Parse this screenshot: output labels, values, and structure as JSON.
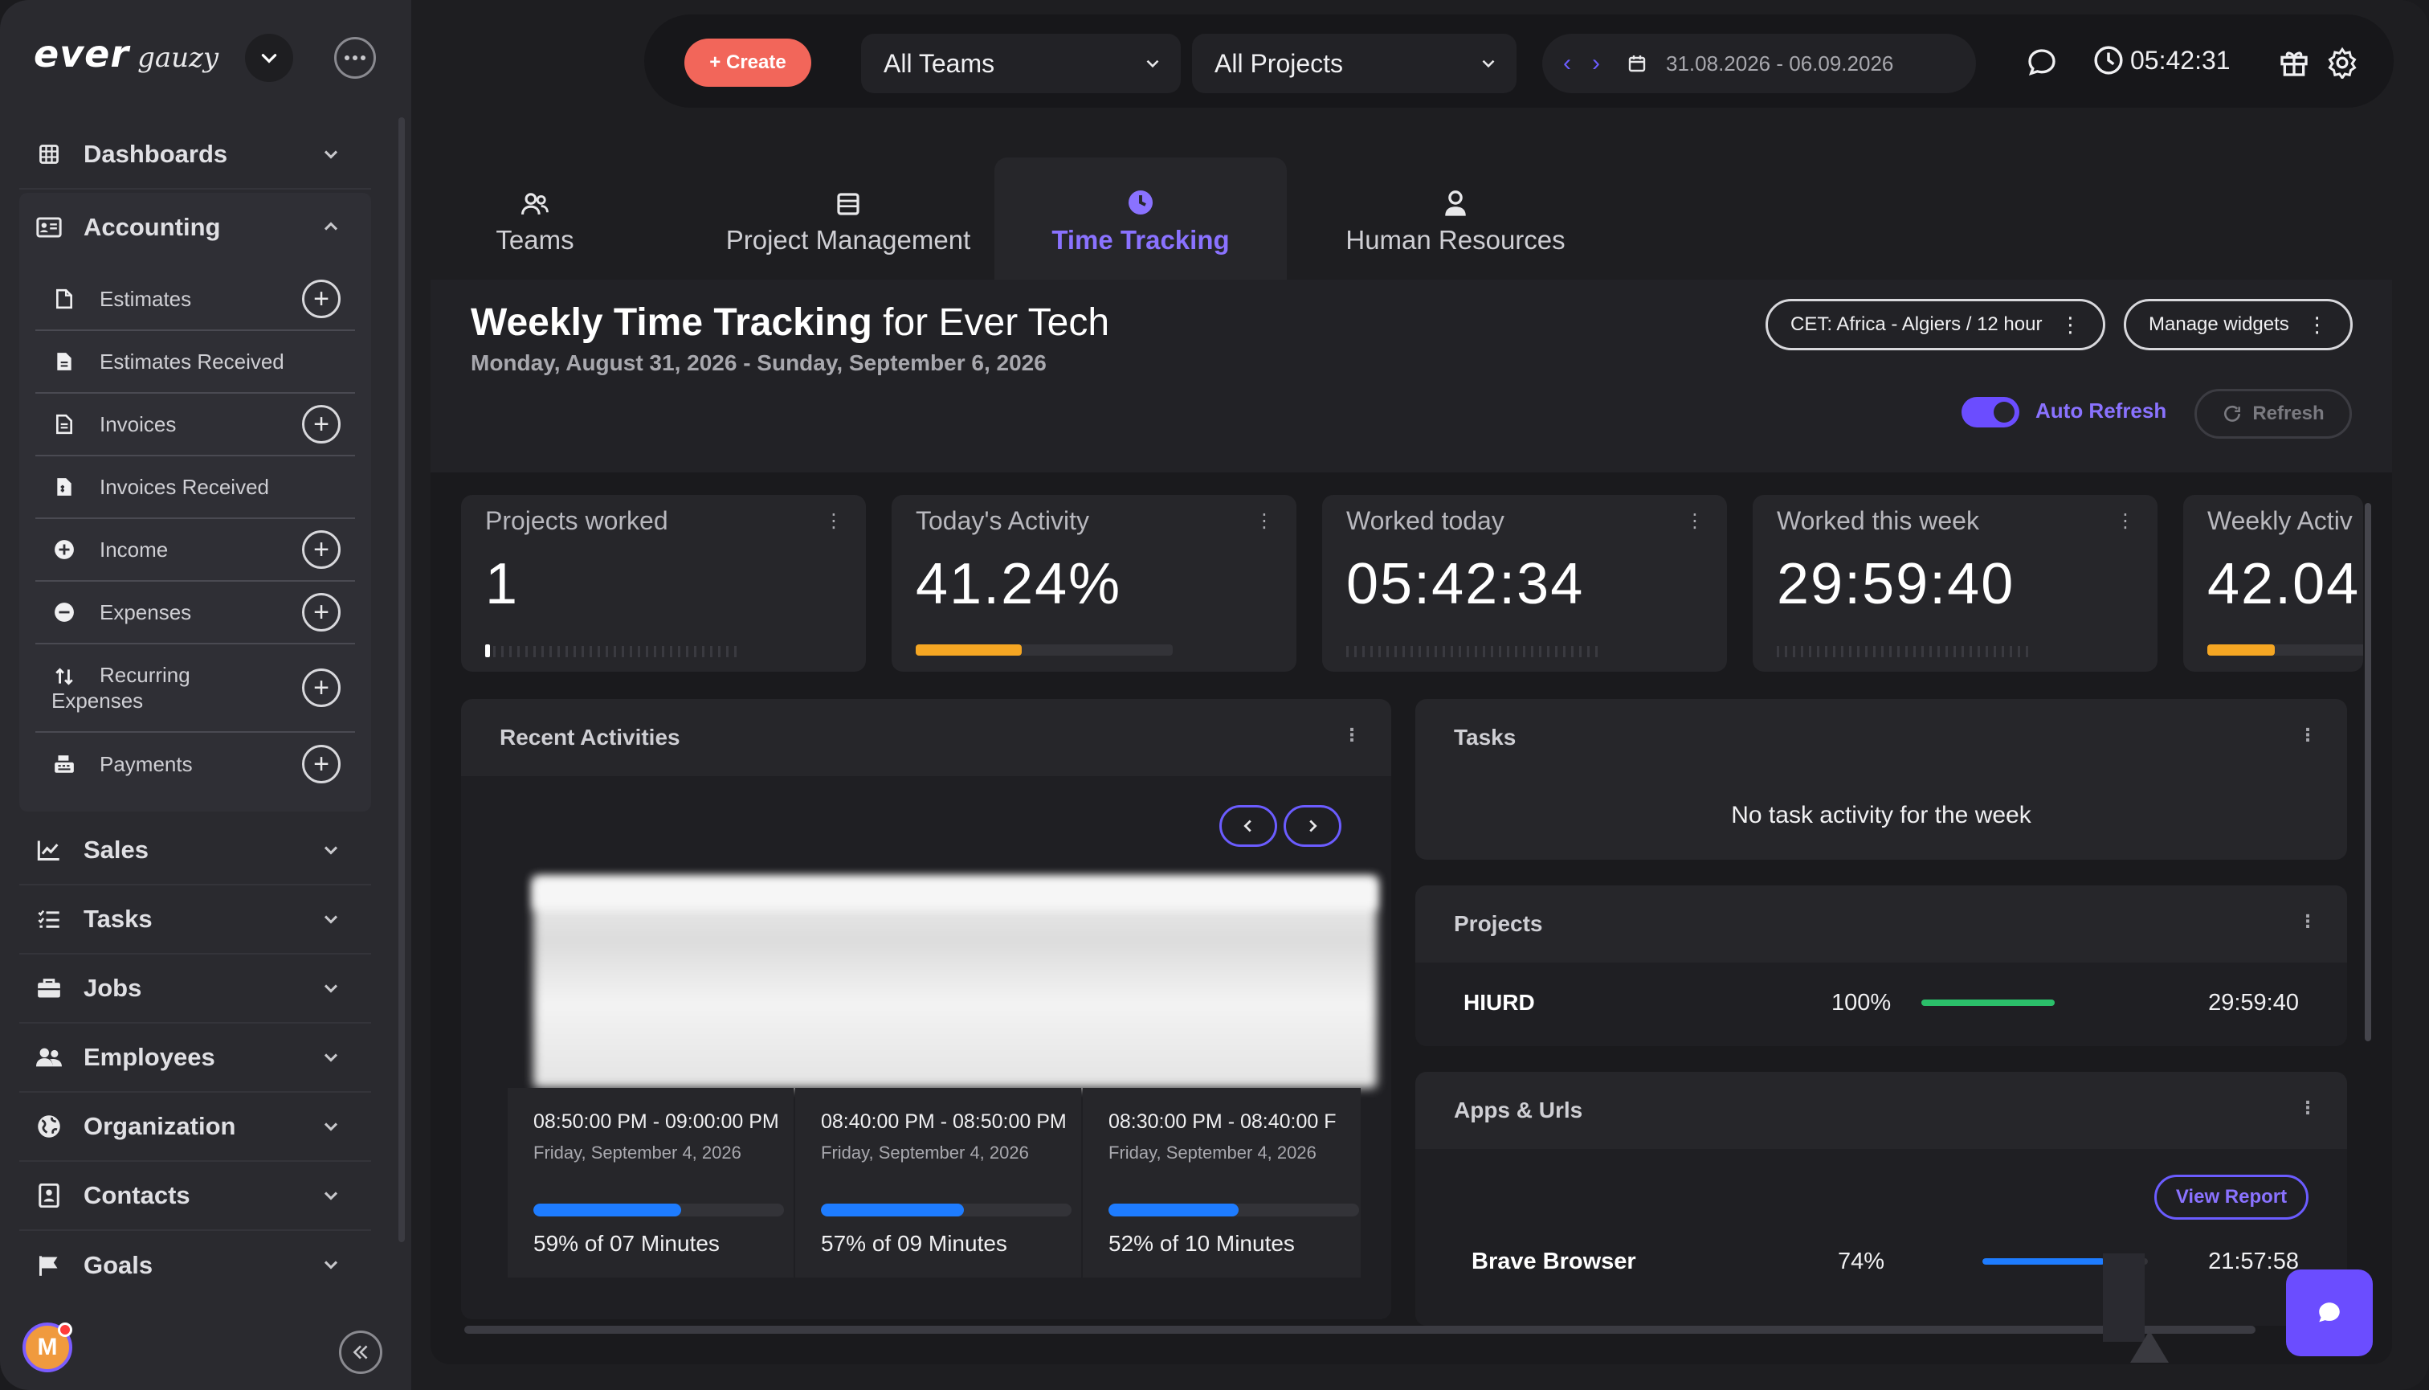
{
  "brand": {
    "name_bold": "ever",
    "name_light": "gauzy"
  },
  "sidebar": {
    "items": [
      {
        "label": "Dashboards",
        "icon": "grid-icon"
      },
      {
        "label": "Accounting",
        "icon": "id-card-icon",
        "expanded": true,
        "children": [
          {
            "label": "Estimates",
            "icon": "file-icon",
            "add": true
          },
          {
            "label": "Estimates Received",
            "icon": "file-filled-icon",
            "add": false
          },
          {
            "label": "Invoices",
            "icon": "invoice-icon",
            "add": true
          },
          {
            "label": "Invoices Received",
            "icon": "invoice-filled-icon",
            "add": false
          },
          {
            "label": "Income",
            "icon": "plus-circle-icon",
            "add": true
          },
          {
            "label": "Expenses",
            "icon": "minus-circle-icon",
            "add": true
          },
          {
            "label": "Recurring Expenses",
            "icon": "swap-icon",
            "add": true
          },
          {
            "label": "Payments",
            "icon": "cash-register-icon",
            "add": true
          }
        ]
      },
      {
        "label": "Sales",
        "icon": "chart-line-icon"
      },
      {
        "label": "Tasks",
        "icon": "list-check-icon"
      },
      {
        "label": "Jobs",
        "icon": "briefcase-icon"
      },
      {
        "label": "Employees",
        "icon": "users-icon"
      },
      {
        "label": "Organization",
        "icon": "globe-icon"
      },
      {
        "label": "Contacts",
        "icon": "contact-book-icon"
      },
      {
        "label": "Goals",
        "icon": "flag-icon"
      }
    ],
    "avatar_initial": "M"
  },
  "topbar": {
    "create_label": "+ Create",
    "team_select": "All Teams",
    "project_select": "All Projects",
    "date_range": "31.08.2026 - 06.09.2026",
    "timer": "05:42:31"
  },
  "tabs": [
    {
      "label": "Teams",
      "active": false
    },
    {
      "label": "Project Management",
      "active": false
    },
    {
      "label": "Time Tracking",
      "active": true
    },
    {
      "label": "Human Resources",
      "active": false
    }
  ],
  "header": {
    "title_bold": "Weekly Time Tracking",
    "title_rest": " for Ever Tech",
    "subtitle": "Monday, August 31, 2026 - Sunday, September 6, 2026",
    "timezone_btn": "CET: Africa - Algiers / 12 hour",
    "manage_widgets_btn": "Manage widgets",
    "auto_refresh_label": "Auto Refresh",
    "auto_refresh_on": true,
    "refresh_btn": "Refresh"
  },
  "stats": [
    {
      "title": "Projects worked",
      "value": "1",
      "progress": null
    },
    {
      "title": "Today's Activity",
      "value": "41.24%",
      "progress": 0.4124
    },
    {
      "title": "Worked today",
      "value": "05:42:34",
      "progress": null
    },
    {
      "title": "Worked this week",
      "value": "29:59:40",
      "progress": null
    },
    {
      "title": "Weekly Activ",
      "value": "42.04",
      "progress": 0.4204
    }
  ],
  "recent_activities": {
    "title": "Recent Activities",
    "items": [
      {
        "time": "08:50:00 PM - 09:00:00 PM",
        "date": "Friday, September 4, 2026",
        "percent": 59,
        "summary": "59% of 07 Minutes"
      },
      {
        "time": "08:40:00 PM - 08:50:00 PM",
        "date": "Friday, September 4, 2026",
        "percent": 57,
        "summary": "57% of 09 Minutes"
      },
      {
        "time": "08:30:00 PM - 08:40:00 F",
        "date": "Friday, September 4, 2026",
        "percent": 52,
        "summary": "52% of 10 Minutes"
      }
    ]
  },
  "tasks": {
    "title": "Tasks",
    "empty_text": "No task activity for the week"
  },
  "projects": {
    "title": "Projects",
    "rows": [
      {
        "name": "HIURD",
        "percent_label": "100%",
        "percent": 100,
        "time": "29:59:40"
      }
    ]
  },
  "apps": {
    "title": "Apps & Urls",
    "view_report": "View Report",
    "rows": [
      {
        "name": "Brave Browser",
        "percent_label": "74%",
        "percent": 74,
        "time": "21:57:58"
      }
    ]
  },
  "colors": {
    "accent": "#6b4dff",
    "create": "#f2665a",
    "activity_bar": "#f5a623",
    "blue_bar": "#1e7cff",
    "green_bar": "#2bbf6a"
  }
}
